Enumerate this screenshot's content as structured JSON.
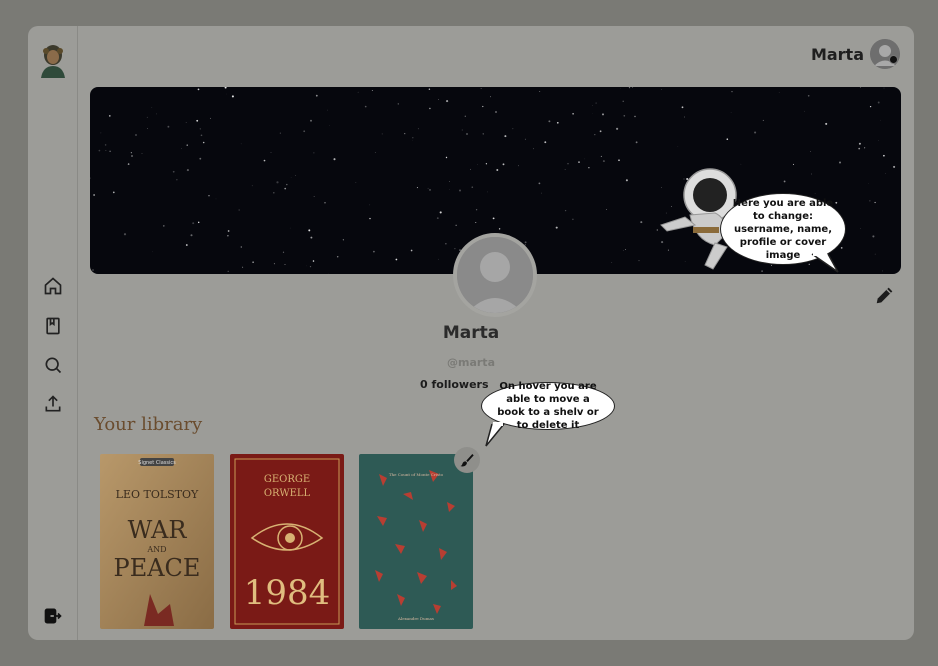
{
  "header": {
    "username": "Marta"
  },
  "profile": {
    "name": "Marta",
    "handle": "@marta",
    "stats": "0 followers"
  },
  "library": {
    "title": "Your library",
    "books": [
      {
        "author": "LEO TOLSTOY",
        "title_line1": "WAR",
        "title_line2": "AND",
        "title_line3": "PEACE",
        "publisher": "Signet Classics"
      },
      {
        "author_line1": "GEORGE",
        "author_line2": "ORWELL",
        "title": "1984"
      },
      {
        "title": "The Count of Monte Cristo",
        "author": "Alexandre Dumas"
      }
    ]
  },
  "tips": {
    "cover_tip": "Here you are able to change: username, name, profile or cover image",
    "book_tip": "On hover you are able to move a book to a shelv or to delete it"
  },
  "icons": {
    "nav": [
      "home-icon",
      "book-icon",
      "search-icon",
      "upload-icon"
    ],
    "logout": "logout-icon",
    "edit": "pencil-icon",
    "book_action": "brush-icon"
  },
  "colors": {
    "accent_brown": "#6a4c2e",
    "cover_bg": "#06070d"
  }
}
